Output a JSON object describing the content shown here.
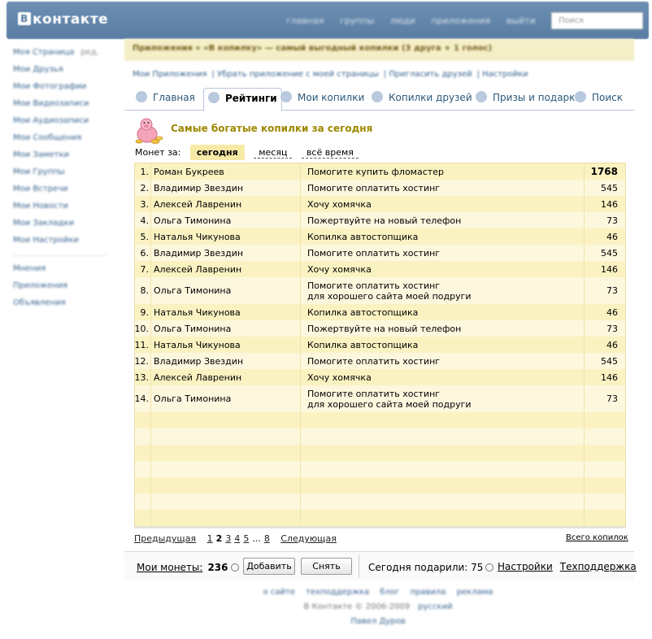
{
  "header": {
    "logo": "контакте",
    "logo_badge": "В",
    "nav": [
      "главная",
      "группы",
      "люди",
      "приложения",
      "выйти"
    ],
    "search_placeholder": "Поиск"
  },
  "sidebar": {
    "items": [
      {
        "label": "Моя Страница",
        "count": "ред."
      },
      {
        "label": "Мои Друзья"
      },
      {
        "label": "Мои Фотографии"
      },
      {
        "label": "Мои Видеозаписи"
      },
      {
        "label": "Мои Аудиозаписи"
      },
      {
        "label": "Мои Сообщения"
      },
      {
        "label": "Мои Заметки"
      },
      {
        "label": "Мои Группы"
      },
      {
        "label": "Мои Встречи"
      },
      {
        "label": "Мои Новости"
      },
      {
        "label": "Мои Закладки"
      },
      {
        "label": "Мои Настройки"
      }
    ],
    "extra": [
      "Мнения",
      "Приложения",
      "Объявления"
    ]
  },
  "breadcrumb": "Приложения » «В копилку» — самый выгодный копилки (3 друга + 1 голос)",
  "subnav": [
    "Мои Приложения",
    "Убрать приложение с моей страницы",
    "Пригласить друзей",
    "Настройки"
  ],
  "tabs": [
    {
      "label": "Главная",
      "active": false
    },
    {
      "label": "Рейтинги",
      "active": true
    },
    {
      "label": "Мои копилки",
      "active": false
    },
    {
      "label": "Копилки друзей",
      "active": false
    },
    {
      "label": "Призы и подарки",
      "active": false
    },
    {
      "label": "Поиск",
      "active": false
    }
  ],
  "section_title": "Самые богатые копилки за сегодня",
  "filter": {
    "label": "Монет за:",
    "options": [
      {
        "label": "сегодня",
        "active": true
      },
      {
        "label": "месяц",
        "active": false
      },
      {
        "label": "всё время",
        "active": false
      }
    ]
  },
  "table": {
    "rows": [
      {
        "rank": "1.",
        "name": "Роман Букреев",
        "title": "Помогите купить фломастер",
        "title2": "",
        "coins": "1768"
      },
      {
        "rank": "2.",
        "name": "Владимир Звездин",
        "title": "Помогите оплатить хостинг",
        "title2": "",
        "coins": "545"
      },
      {
        "rank": "3.",
        "name": "Алексей Лавренин",
        "title": "Хочу хомячка",
        "title2": "",
        "coins": "146"
      },
      {
        "rank": "4.",
        "name": "Ольга Тимонина",
        "title": "Пожертвуйте на новый телефон",
        "title2": "",
        "coins": "73"
      },
      {
        "rank": "5.",
        "name": "Наталья Чикунова",
        "title": "Копилка автостопщика",
        "title2": "",
        "coins": "46"
      },
      {
        "rank": "6.",
        "name": "Владимир Звездин",
        "title": "Помогите оплатить хостинг",
        "title2": "",
        "coins": "545"
      },
      {
        "rank": "7.",
        "name": "Алексей Лавренин",
        "title": "Хочу хомячка",
        "title2": "",
        "coins": "146"
      },
      {
        "rank": "8.",
        "name": "Ольга Тимонина",
        "title": "Помогите оплатить хостинг",
        "title2": "для хорошего сайта моей подруги",
        "coins": "73"
      },
      {
        "rank": "9.",
        "name": "Наталья Чикунова",
        "title": "Копилка автостопщика",
        "title2": "",
        "coins": "46"
      },
      {
        "rank": "10.",
        "name": "Ольга Тимонина",
        "title": "Пожертвуйте на новый телефон",
        "title2": "",
        "coins": "73"
      },
      {
        "rank": "11.",
        "name": "Наталья Чикунова",
        "title": "Копилка автостопщика",
        "title2": "",
        "coins": "46"
      },
      {
        "rank": "12.",
        "name": "Владимир Звездин",
        "title": "Помогите оплатить хостинг",
        "title2": "",
        "coins": "545"
      },
      {
        "rank": "13.",
        "name": "Алексей Лавренин",
        "title": "Хочу хомячка",
        "title2": "",
        "coins": "146"
      },
      {
        "rank": "14.",
        "name": "Ольга Тимонина",
        "title": "Помогите оплатить хостинг",
        "title2": "для хорошего сайта моей подруги",
        "coins": "73"
      }
    ],
    "empty_rows": 7
  },
  "pager": {
    "prev": "Предыдущая",
    "pages": [
      "1",
      "2",
      "3",
      "4",
      "5"
    ],
    "current": "2",
    "ellipsis": "...",
    "last": "8",
    "next": "Следующая",
    "total": "Всего копилок"
  },
  "bottom_bar": {
    "coins_label": "Мои монеты:",
    "coins_value": "236",
    "add_button": "Добавить",
    "withdraw_button": "Снять",
    "today_label": "Сегодня подарили: 75",
    "settings_link": "Настройки",
    "support_link": "Техподдержка"
  },
  "footer": {
    "links": [
      "о сайте",
      "техподдержка",
      "блог",
      "правила",
      "реклама"
    ],
    "copyright": "В Контакте © 2006-2009",
    "lang": "русский",
    "author": "Павел Дуров"
  }
}
